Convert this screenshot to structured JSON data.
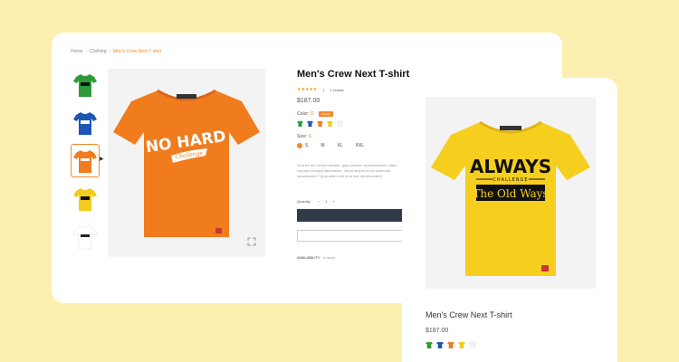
{
  "breadcrumb": {
    "home": "Home",
    "category": "Clothing",
    "current": "Men's Crew Next T-shirt"
  },
  "product": {
    "title": "Men's Crew Next T-shirt",
    "stars": "★★★★★",
    "rating_count": "1",
    "reviews": "1 review",
    "price": "$187.00",
    "color_label": "Color:",
    "color_value": "O",
    "color_tooltip": "Orange",
    "size_label": "Size:",
    "size_value": "S",
    "sizes": [
      "S",
      "M",
      "XL",
      "XXL"
    ],
    "description": "Ut enim ad minima veniam, quis nostrum exercitationem ullam corporis suscipit laboriosam, nisi ut aliquid ex ea commodi consequatur? Quis autem vel eum iure reprehenderit",
    "quantity_label": "Quantity",
    "quantity_minus": "−",
    "quantity_value": "1",
    "quantity_plus": "+",
    "availability_label": "AVAILABILITY",
    "availability_value": "In stock"
  },
  "main_shirt": {
    "color": "#f07c1e",
    "text_line1": "NO HARD",
    "text_line2": "Challenge"
  },
  "thumbnails": [
    {
      "color": "#2e9a3a",
      "text": "ALWAYS"
    },
    {
      "color": "#1d55b5",
      "text": "ALWAYS"
    },
    {
      "color": "#f07c1e",
      "text": "ADD"
    },
    {
      "color": "#f2cc1c",
      "text": "ALWAYS"
    },
    {
      "color": "#ffffff",
      "text": "ALWAYS"
    }
  ],
  "swatch_colors": [
    "#2e9a3a",
    "#1d55b5",
    "#f07c1e",
    "#f2cc1c",
    "#e0e0e0"
  ],
  "side_card": {
    "title": "Men's Crew Next T-shirt",
    "price": "$187.00",
    "shirt_color": "#f6cf1e",
    "text_line1": "ALWAYS",
    "text_line2": "CHALLENGE",
    "text_line3": "The Old Ways"
  }
}
